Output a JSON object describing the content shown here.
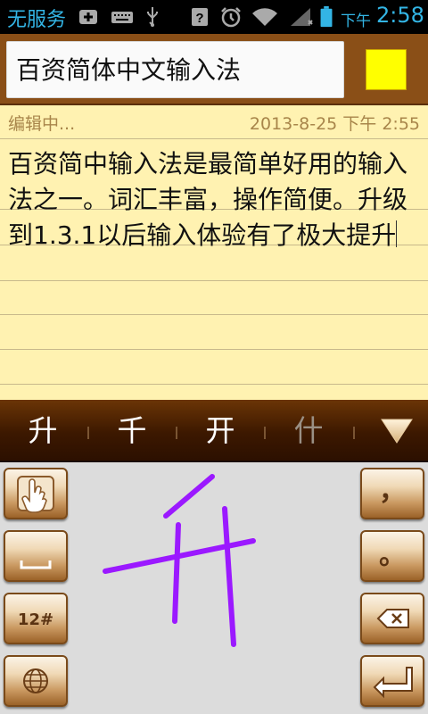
{
  "status_bar": {
    "carrier": "无服务",
    "ampm": "下午",
    "time": "2:58",
    "icons": [
      "add-icon",
      "keyboard-icon",
      "usb-icon",
      "signal-unknown-icon",
      "alarm-icon",
      "wifi-icon",
      "no-signal-icon",
      "battery-icon"
    ]
  },
  "title_bar": {
    "title": "百资简体中文输入法",
    "note_color": "#ffff00"
  },
  "note": {
    "status": "编辑中...",
    "timestamp": "2013-8-25 下午 2:55",
    "body": "百资简中输入法是最简单好用的输入法之一。词汇丰富，操作简便。升级到1.3.1以后输入体验有了极大提升"
  },
  "candidates": [
    {
      "label": "升",
      "dimmed": false
    },
    {
      "label": "千",
      "dimmed": false
    },
    {
      "label": "开",
      "dimmed": false
    },
    {
      "label": "什",
      "dimmed": true
    }
  ],
  "keyboard": {
    "left_keys": [
      {
        "name": "hand-mode-key",
        "icon": "hand-icon"
      },
      {
        "name": "space-key",
        "icon": "space-icon"
      },
      {
        "name": "number-mode-key",
        "label": "12#"
      },
      {
        "name": "language-key",
        "icon": "globe-icon"
      }
    ],
    "right_keys": [
      {
        "name": "comma-key",
        "label": "，"
      },
      {
        "name": "period-key",
        "label": "。"
      },
      {
        "name": "backspace-key",
        "icon": "backspace-icon"
      },
      {
        "name": "enter-key",
        "icon": "enter-icon"
      }
    ],
    "ink_color": "#9b19ff"
  },
  "colors": {
    "accent": "#33b5e5",
    "title_bar": "#8a4f17",
    "note_paper": "#fff2b1",
    "candidate_bar": "#3c1800"
  }
}
